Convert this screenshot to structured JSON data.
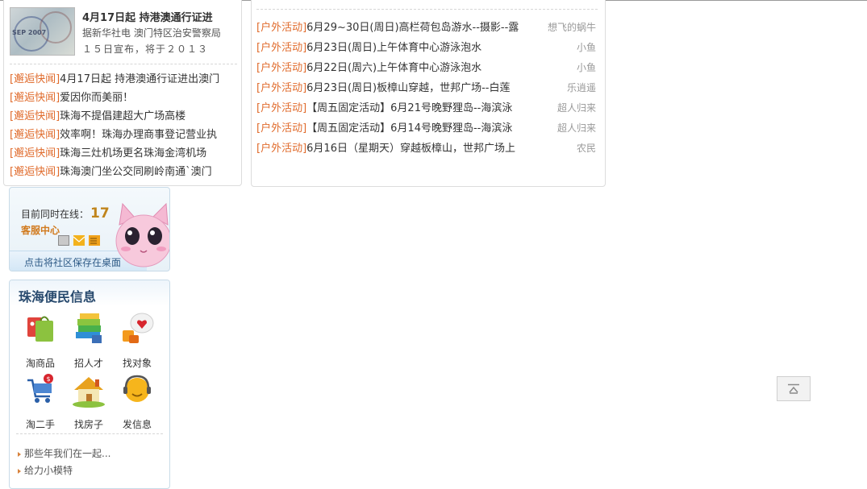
{
  "news": {
    "thumb_stamp_text": "SEP 2007",
    "headline": "4月17日起 持港澳通行证进",
    "summary_lines": [
      "据新华社电 澳门特区治安警察局",
      "１５日宣布，将于２０１３"
    ],
    "items": [
      {
        "tag": "[邂逅快闻]",
        "text": "4月17日起 持港澳通行证进出澳门"
      },
      {
        "tag": "[邂逅快闻]",
        "text": "爱因你而美丽！"
      },
      {
        "tag": "[邂逅快闻]",
        "text": "珠海不提倡建超大广场高楼"
      },
      {
        "tag": "[邂逅快闻]",
        "text": "效率啊！珠海办理商事登记营业执"
      },
      {
        "tag": "[邂逅快闻]",
        "text": "珠海三灶机场更名珠海金湾机场"
      },
      {
        "tag": "[邂逅快闻]",
        "text": "珠海澳门坐公交同刷岭南通`澳门"
      }
    ]
  },
  "activities": {
    "items": [
      {
        "tag": "[户外活动]",
        "text": "6月29~30日(周日)高栏荷包岛游水--摄影--露",
        "author": "想飞的蜗牛"
      },
      {
        "tag": "[户外活动]",
        "text": "6月23日(周日)上午体育中心游泳泡水",
        "author": "小鱼"
      },
      {
        "tag": "[户外活动]",
        "text": "6月22日(周六)上午体育中心游泳泡水",
        "author": "小鱼"
      },
      {
        "tag": "[户外活动]",
        "text": "6月23日(周日)板樟山穿越，世邦广场--白莲",
        "author": "乐逍遥"
      },
      {
        "tag": "[户外活动]",
        "text": "【周五固定活动】6月21号晚野狸岛--海滨泳",
        "author": "超人归来"
      },
      {
        "tag": "[户外活动]",
        "text": "【周五固定活动】6月14号晚野狸岛--海滨泳",
        "author": "超人归来"
      },
      {
        "tag": "[户外活动]",
        "text": "6月16日（星期天）穿越板樟山，世邦广场上",
        "author": "农民"
      }
    ]
  },
  "online": {
    "label": "目前同时在线：",
    "count": "17",
    "service": "客服中心",
    "bookmark": "点击将社区保存在桌面"
  },
  "convenience": {
    "title": "珠海便民信息",
    "items": [
      {
        "label": "淘商品",
        "icon": "shopping-bag-icon"
      },
      {
        "label": "招人才",
        "icon": "books-icon"
      },
      {
        "label": "找对象",
        "icon": "heart-bubble-icon"
      },
      {
        "label": "淘二手",
        "icon": "cart-icon"
      },
      {
        "label": "找房子",
        "icon": "house-icon"
      },
      {
        "label": "发信息",
        "icon": "chat-face-icon"
      }
    ],
    "links": [
      "那些年我们在一起...",
      "给力小模特"
    ]
  },
  "colors": {
    "tag": "#e06b2c",
    "count": "#c0851c",
    "service": "#d17a1e",
    "title": "#27496d"
  }
}
